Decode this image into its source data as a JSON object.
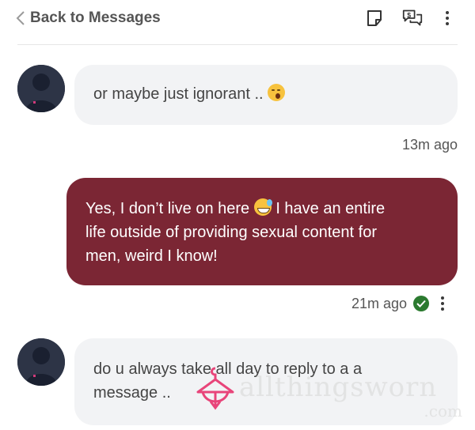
{
  "header": {
    "back_label": "Back to Messages",
    "icons": [
      "note-icon",
      "paid-chat-icon",
      "more-icon"
    ]
  },
  "messages": [
    {
      "direction": "incoming",
      "text": "or maybe just ignorant ..",
      "emoji": "yawning-face",
      "time": "13m ago"
    },
    {
      "direction": "outgoing",
      "text_line1_a": "Yes, I don’t live on here",
      "emoji": "grinning-sweat-face",
      "text_line1_b": "I have an entire",
      "text_line2": "life outside of providing sexual content for",
      "text_line3": "men, weird I know!",
      "time": "21m ago",
      "status": "delivered"
    },
    {
      "direction": "incoming",
      "text_line1": "do u always take all day to reply to a a",
      "text_line2": "message .."
    }
  ],
  "watermark": {
    "text": "allthingsworn",
    "domain": ".com"
  },
  "colors": {
    "outgoing_bubble": "#7b2634",
    "incoming_bubble": "#f2f3f5",
    "check": "#2b7a2f",
    "watermark_logo": "#e8457a"
  }
}
